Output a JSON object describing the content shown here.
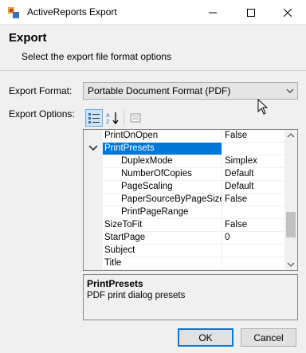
{
  "window": {
    "title": "ActiveReports Export",
    "app_icon": "activereports-icon",
    "controls": {
      "minimize": "minimize-icon",
      "maximize": "maximize-icon",
      "close": "close-icon"
    }
  },
  "header": {
    "title": "Export",
    "subtitle": "Select the export file format options"
  },
  "format": {
    "label": "Export Format:",
    "selected": "Portable Document Format (PDF)"
  },
  "options": {
    "label": "Export Options:",
    "toolbar": [
      "categorized-icon",
      "alphabetical-sort-icon",
      "property-pages-icon"
    ],
    "rows": [
      {
        "name": "PrintOnOpen",
        "value": "False"
      },
      {
        "name": "PrintPresets",
        "value": "",
        "category": true
      },
      {
        "name": "DuplexMode",
        "value": "Simplex",
        "indent": true
      },
      {
        "name": "NumberOfCopies",
        "value": "Default",
        "indent": true
      },
      {
        "name": "PageScaling",
        "value": "Default",
        "indent": true
      },
      {
        "name": "PaperSourceByPageSize",
        "value": "False",
        "indent": true
      },
      {
        "name": "PrintPageRange",
        "value": "",
        "indent": true
      },
      {
        "name": "SizeToFit",
        "value": "False"
      },
      {
        "name": "StartPage",
        "value": "0"
      },
      {
        "name": "Subject",
        "value": ""
      },
      {
        "name": "Title",
        "value": ""
      }
    ]
  },
  "description": {
    "title": "PrintPresets",
    "text": "PDF print dialog presets"
  },
  "buttons": {
    "ok": "OK",
    "cancel": "Cancel"
  },
  "colors": {
    "selection": "#0078d7",
    "background": "#f0f0f0"
  }
}
